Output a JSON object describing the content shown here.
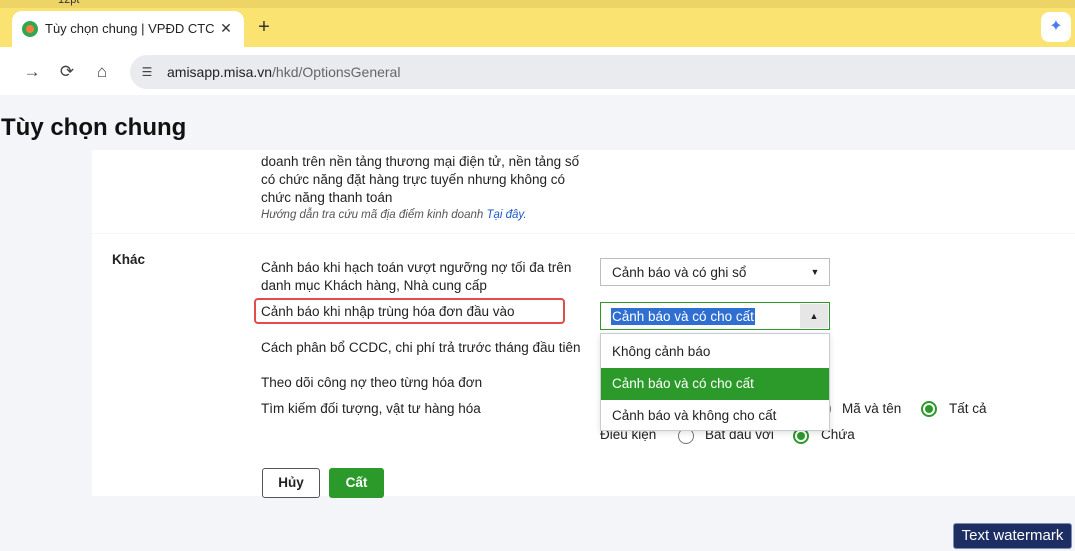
{
  "toolbar_strip": {
    "font_size": "12pt"
  },
  "browser": {
    "tab_title": "Tùy chọn chung | VPĐD CTCP M",
    "tab_close": "✕",
    "new_tab": "+",
    "url_host": "amisapp.misa.vn",
    "url_path": "/hkd/OptionsGeneral",
    "nav": {
      "forward": "→",
      "reload": "⟳",
      "home": "⌂"
    }
  },
  "page": {
    "title": "Tùy chọn chung",
    "description": "doanh trên nền tảng thương mại điện tử, nền tảng số có chức năng đặt hàng trực tuyến nhưng không có chức năng thanh toán",
    "hint_text": "Hướng dẫn tra cứu mã địa điểm kinh doanh ",
    "hint_link": "Tại đây."
  },
  "section": {
    "label": "Khác",
    "rows": {
      "debt_warning": "Cảnh báo khi hạch toán vượt ngưỡng nợ tối đa trên danh mục Khách hàng, Nhà cung cấp",
      "duplicate_invoice": "Cảnh báo khi nhập trùng hóa đơn đầu vào",
      "ccdc_allocation": "Cách phân bổ CCDC, chi phí trả trước tháng đầu tiên",
      "track_debt": "Theo dõi công nợ theo từng hóa đơn",
      "search_objects": "Tìm kiếm đối tượng, vật tư hàng hóa"
    },
    "debt_warning_value": "Cảnh báo và có ghi sổ",
    "duplicate_invoice_value": "Cảnh báo và có cho cất",
    "dropdown_options": [
      "Không cảnh báo",
      "Cảnh báo và có cho cất",
      "Cảnh báo và không cho cất"
    ],
    "selected_option_index": 1,
    "search_radios": {
      "row1": [
        {
          "label": "Mã và tên",
          "checked": false
        },
        {
          "label": "Tất cả",
          "checked": true
        }
      ],
      "condition_label": "Điều kiện",
      "row2": [
        {
          "label": "Bắt đầu với",
          "checked": false
        },
        {
          "label": "Chứa",
          "checked": true
        }
      ]
    }
  },
  "buttons": {
    "cancel": "Hủy",
    "save": "Cất"
  },
  "watermark": "Text watermark",
  "colors": {
    "accent_green": "#2c9a2a",
    "highlight_red": "#e24c4b",
    "tabbar_yellow": "#fbe372",
    "selection_blue": "#2f6fd1"
  }
}
